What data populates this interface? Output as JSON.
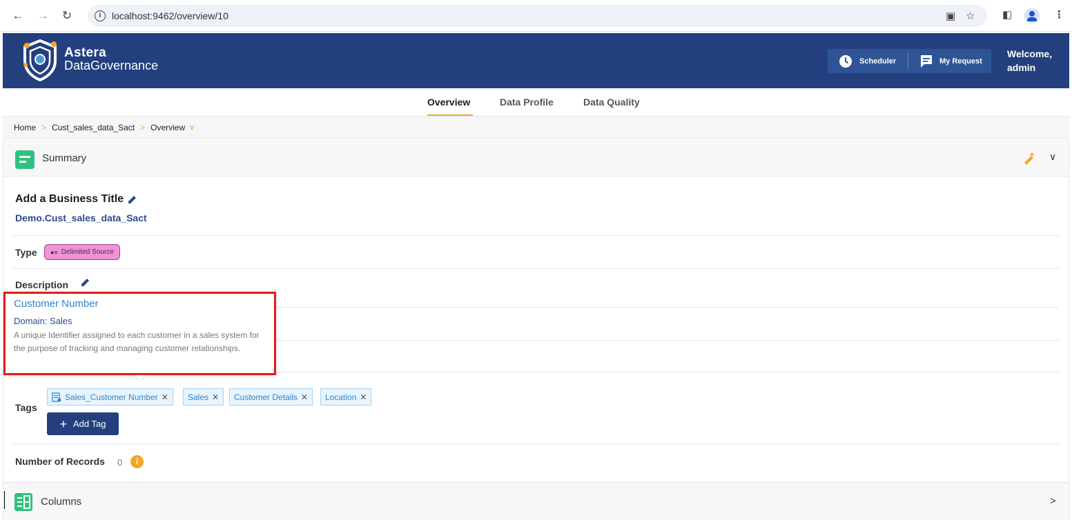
{
  "browser": {
    "url": "localhost:9462/overview/10"
  },
  "app": {
    "brand_line1": "Astera",
    "brand_line2": "DataGovernance",
    "scheduler_label": "Scheduler",
    "my_request_label": "My Request",
    "welcome_line1": "Welcome,",
    "welcome_line2": "admin",
    "header_color": "#233f7e",
    "accent_color": "#f5a623"
  },
  "tabs": [
    {
      "label": "Overview",
      "active": true
    },
    {
      "label": "Data Profile",
      "active": false
    },
    {
      "label": "Data Quality",
      "active": false
    }
  ],
  "breadcrumb": {
    "home": "Home",
    "dataset": "Cust_sales_data_Sact",
    "current": "Overview"
  },
  "summary": {
    "header": "Summary",
    "business_title": "Add a Business Title",
    "dataset_name": "Demo.Cust_sales_data_Sact",
    "type_label": "Type",
    "type_value": "Delimited Source",
    "description_label": "Description",
    "tags_label": "Tags",
    "tags": [
      {
        "label": "Sales_Customer Number",
        "has_icon": true
      },
      {
        "label": "Sales",
        "has_icon": false
      },
      {
        "label": "Customer Details",
        "has_icon": false
      },
      {
        "label": "Location",
        "has_icon": false
      }
    ],
    "add_tag_label": "Add Tag",
    "records_label": "Number of Records",
    "records_value": "0",
    "info_glyph": "i"
  },
  "columns": {
    "header": "Columns"
  },
  "tooltip": {
    "title": "Customer Number",
    "domain": "Domain: Sales",
    "description": "A unique Identifier assigned to each customer in a sales system for the purpose of tracking and managing customer relationships."
  }
}
